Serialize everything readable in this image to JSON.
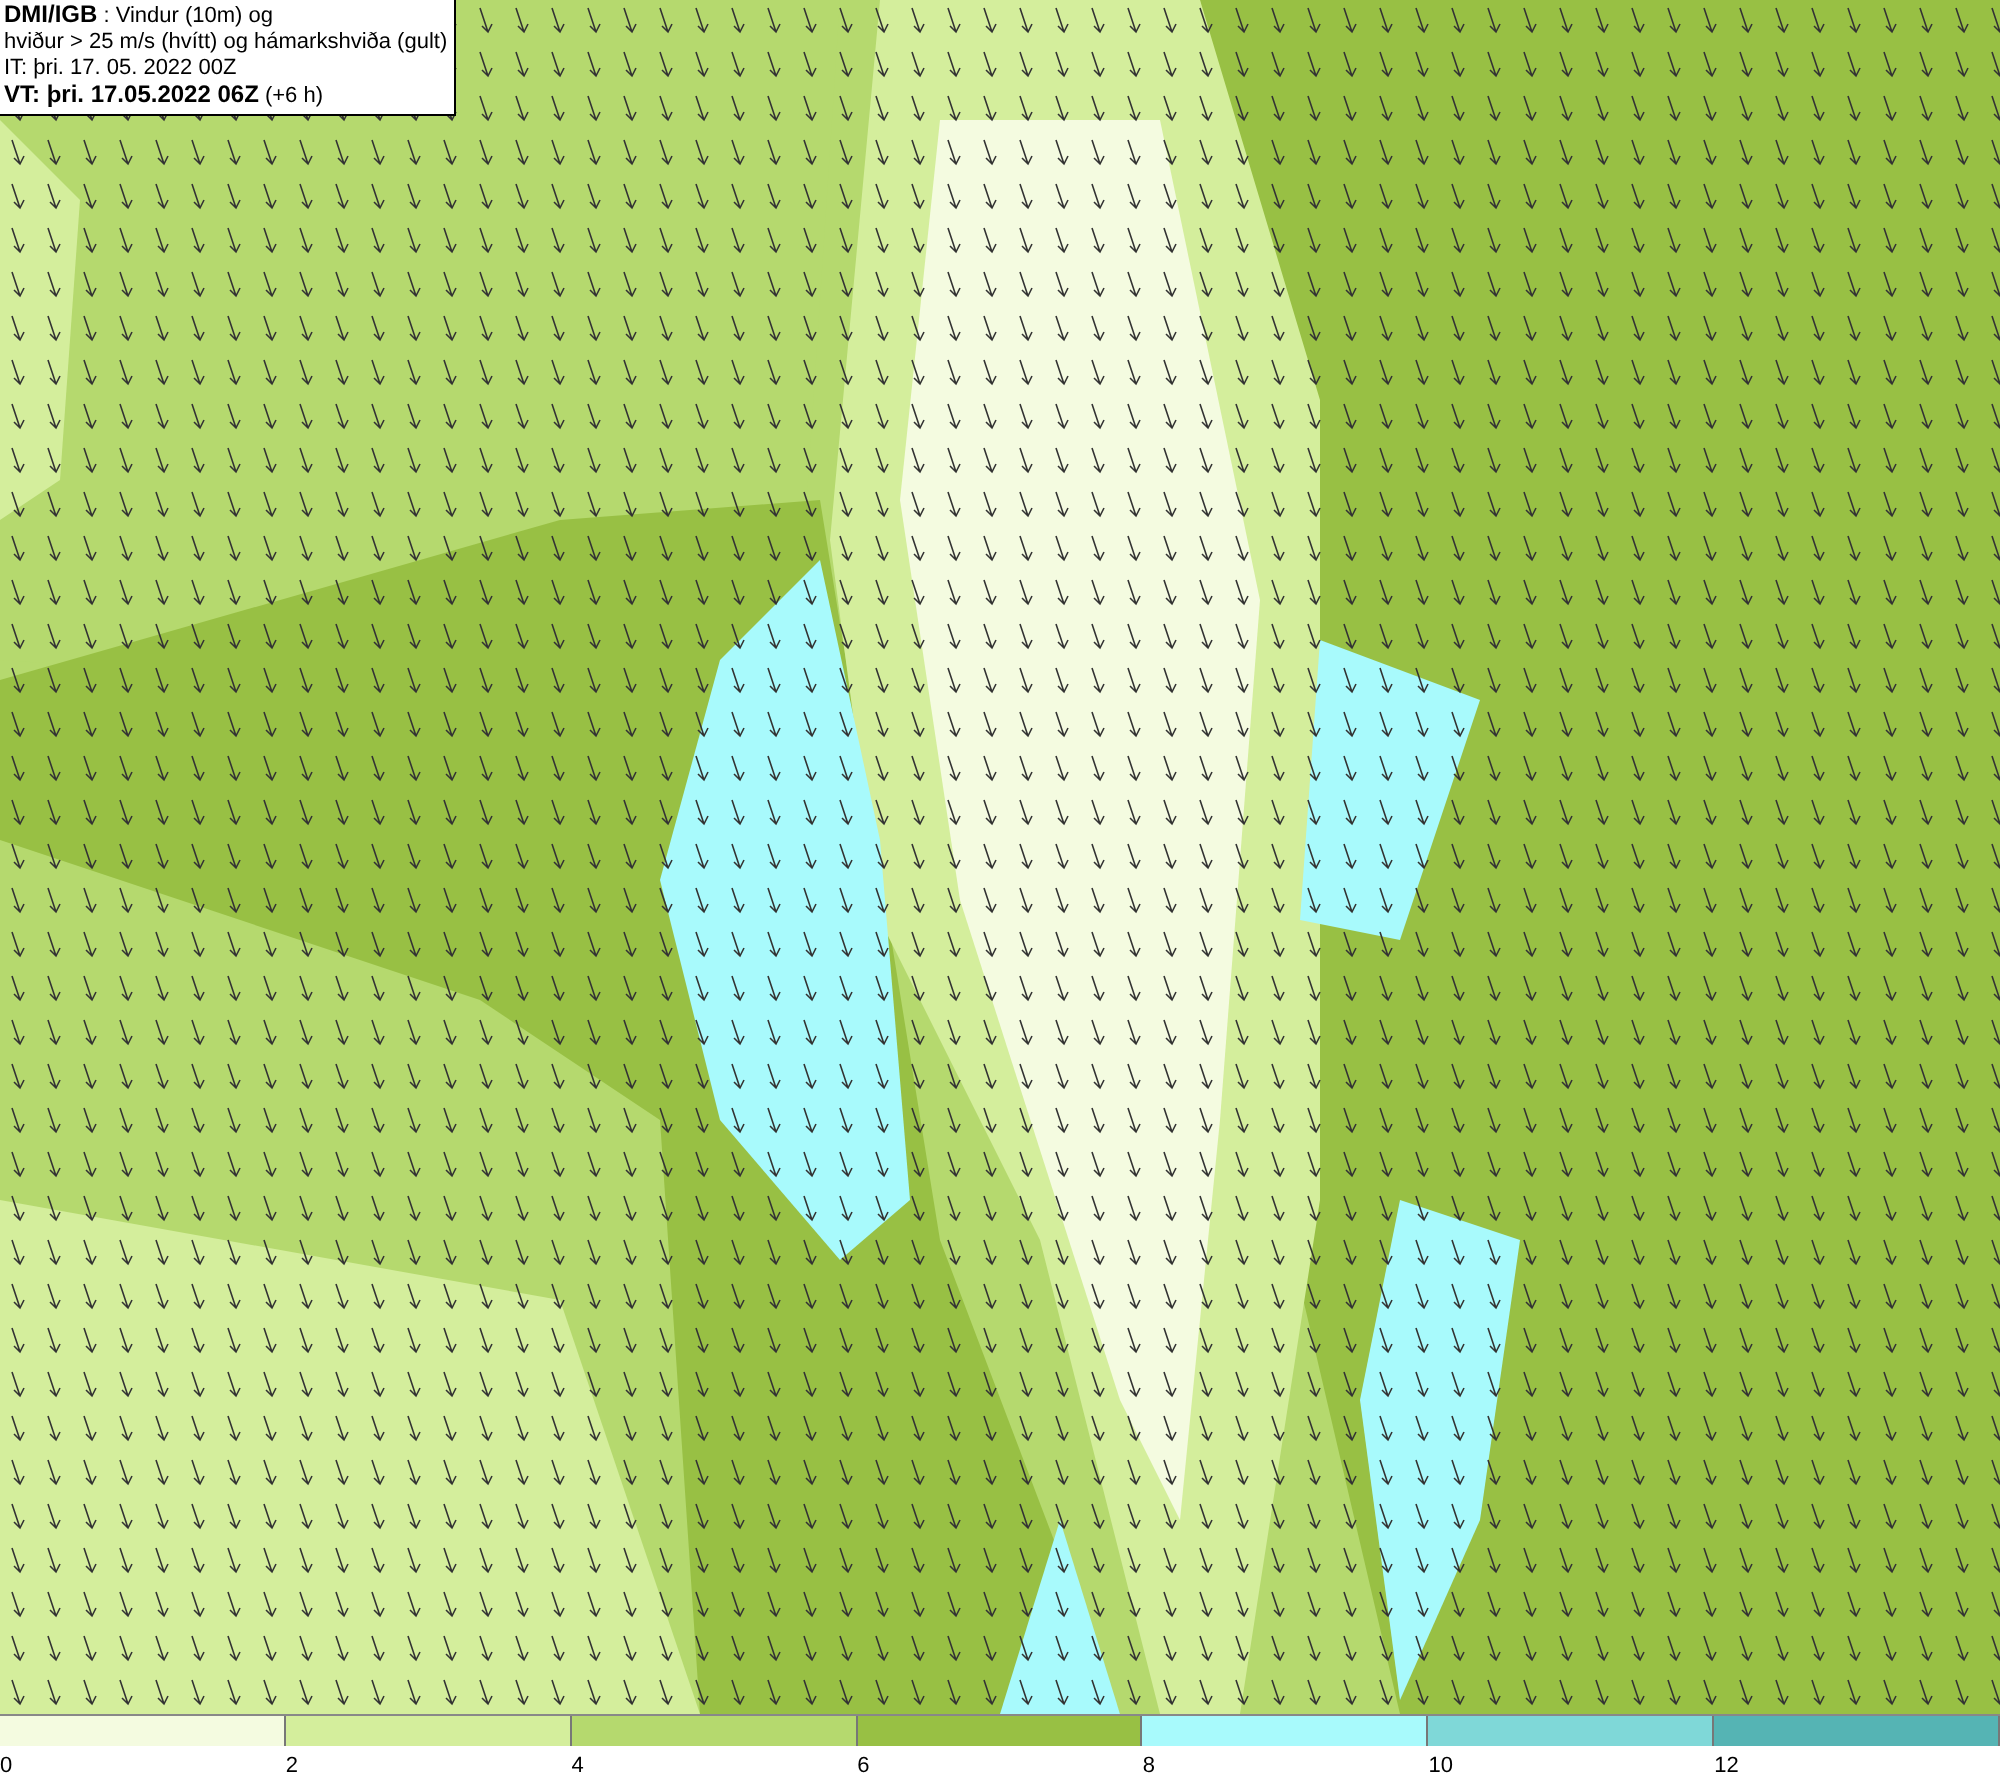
{
  "header": {
    "lines": [
      "**DMI/IGB** : Vindur (10m) og",
      "hviður > 25 m/s (hvítt) og hámarkshviða (gult)",
      "IT: þri. 17. 05. 2022 00Z",
      "**VT: þri. 17.05.2022 06Z** (+6 h)"
    ]
  },
  "legend": {
    "bins": [
      {
        "color": "#f4fbe0",
        "label": "0"
      },
      {
        "color": "#d4ee9c",
        "label": "2"
      },
      {
        "color": "#b5d96e",
        "label": "4"
      },
      {
        "color": "#98c044",
        "label": "6"
      },
      {
        "color": "#a8fafc",
        "label": "8"
      },
      {
        "color": "#7fd8d8",
        "label": "10"
      },
      {
        "color": "#55b4b4",
        "label": "12"
      }
    ]
  }
}
